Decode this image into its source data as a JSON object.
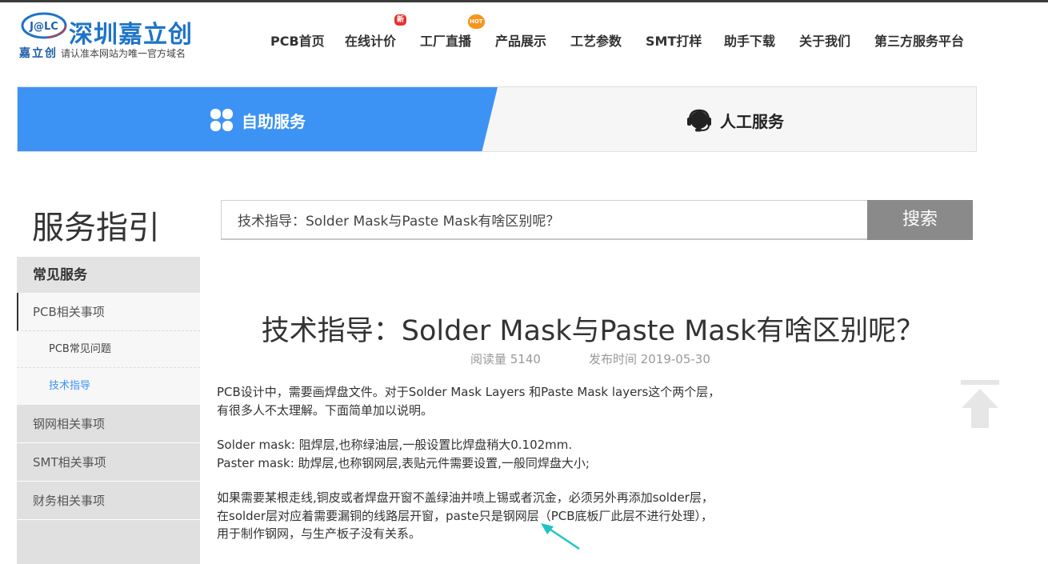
{
  "header": {
    "logo_badge": "J@LC",
    "logo_name": "深圳嘉立创",
    "logo_brand_mark": "嘉立创",
    "logo_sub": "请认准本网站为唯一官方域名",
    "nav": [
      {
        "label": "PCB首页"
      },
      {
        "label": "在线计价",
        "badge": "新"
      },
      {
        "label": "工厂直播",
        "badge": "HOT"
      },
      {
        "label": "产品展示"
      },
      {
        "label": "工艺参数"
      },
      {
        "label": "SMT打样"
      },
      {
        "label": "助手下载"
      },
      {
        "label": "关于我们"
      },
      {
        "label": "第三方服务平台"
      }
    ]
  },
  "service_bar": {
    "self_service": "自助服务",
    "human_service": "人工服务",
    "colors": {
      "active": "#3d93f4",
      "inactive": "#f6f6f6"
    }
  },
  "sidebar": {
    "title": "服务指引",
    "section_head": "常见服务",
    "items": [
      {
        "label": "PCB相关事项"
      },
      {
        "label": "PCB常见问题"
      },
      {
        "label": "技术指导"
      },
      {
        "label": "钢网相关事项"
      },
      {
        "label": "SMT相关事项"
      },
      {
        "label": "财务相关事项"
      }
    ]
  },
  "search": {
    "value": "技术指导：Solder Mask与Paste Mask有啥区别呢？",
    "button": "搜索"
  },
  "article": {
    "title": "技术指导：Solder Mask与Paste Mask有啥区别呢？",
    "reads": "阅读量 5140",
    "published": "发布时间 2019-05-30",
    "lines": [
      "PCB设计中，需要画焊盘文件。对于Solder Mask Layers 和Paste Mask layers这个两个层，",
      "有很多人不太理解。下面简单加以说明。",
      "",
      "Solder mask: 阻焊层,也称绿油层,一般设置比焊盘稍大0.102mm.",
      "Paster mask: 助焊层,也称钢网层,表贴元件需要设置,一般同焊盘大小;",
      "",
      "如果需要某根走线,铜皮或者焊盘开窗不盖绿油并喷上锡或者沉金，必须另外再添加solder层，",
      "在solder层对应着需要漏铜的线路层开窗，paste只是钢网层（PCB底板厂此层不进行处理），",
      "用于制作钢网，与生产板子没有关系。"
    ]
  }
}
